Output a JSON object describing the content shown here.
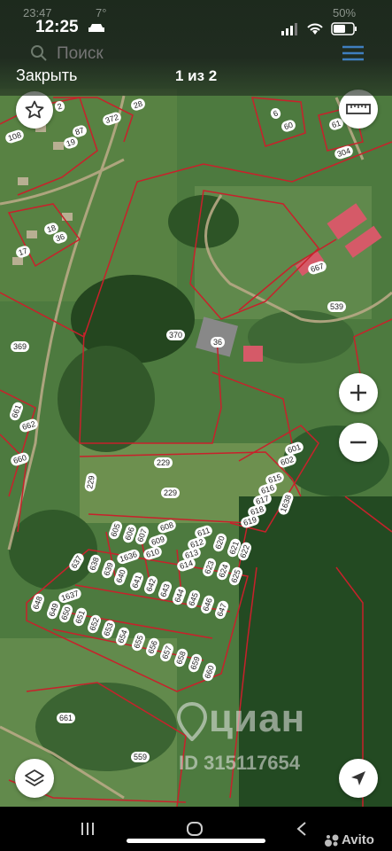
{
  "status_ghost": {
    "time": "23:47",
    "extra": "7°",
    "battery": "50%"
  },
  "status": {
    "time": "12:25"
  },
  "search": {
    "placeholder": "Поиск"
  },
  "viewer": {
    "close_label": "Закрыть",
    "counter": "1 из 2"
  },
  "watermark": {
    "brand": "циан",
    "id_text": "ID 315117654"
  },
  "footer": {
    "brand": "Avito"
  },
  "parcels": [
    "2",
    "6",
    "60",
    "61",
    "304",
    "108",
    "372",
    "28",
    "87",
    "19",
    "36",
    "18",
    "17",
    "667",
    "539",
    "369",
    "370",
    "36",
    "661",
    "662",
    "660",
    "229",
    "229",
    "229",
    "601",
    "602",
    "615",
    "616",
    "617",
    "618",
    "619",
    "1638",
    "605",
    "606",
    "607",
    "608",
    "609",
    "610",
    "611",
    "612",
    "613",
    "614",
    "620",
    "621",
    "622",
    "623",
    "624",
    "625",
    "1636",
    "637",
    "638",
    "639",
    "640",
    "641",
    "1637",
    "642",
    "643",
    "644",
    "645",
    "646",
    "647",
    "648",
    "649",
    "650",
    "651",
    "652",
    "653",
    "654",
    "655",
    "656",
    "657",
    "658",
    "659",
    "660",
    "661",
    "559",
    "559"
  ],
  "icons": [
    "star-icon",
    "ruler-icon",
    "zoom-in-icon",
    "zoom-out-icon",
    "layers-icon",
    "locate-icon",
    "menu-icon",
    "search-icon",
    "wifi-icon",
    "battery-icon",
    "signal-icon"
  ]
}
